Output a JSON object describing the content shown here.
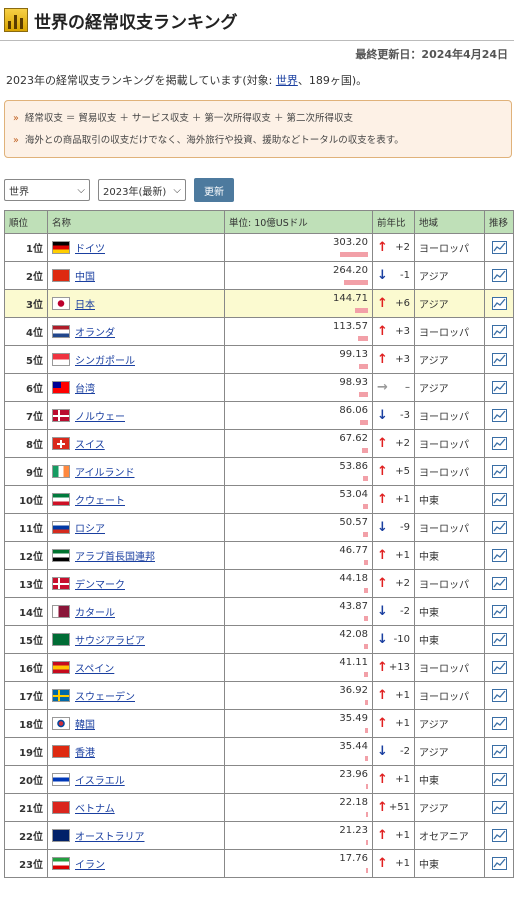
{
  "header": {
    "title": "世界の経常収支ランキング"
  },
  "updated": "最終更新日：2024年4月24日",
  "intro": {
    "before": "2023年の経常収支ランキングを掲載しています(対象: ",
    "link": "世界",
    "after": "、189ヶ国)。"
  },
  "notes": [
    "経常収支 ＝ 貿易収支 ＋ サービス収支 ＋ 第一次所得収支 ＋ 第二次所得収支",
    "海外との商品取引の収支だけでなく、海外旅行や投資、援助などトータルの収支を表す。"
  ],
  "controls": {
    "region": "世界",
    "year": "2023年(最新)",
    "update": "更新"
  },
  "table": {
    "headers": [
      "順位",
      "名称",
      "単位: 10億USドル",
      "前年比",
      "地域",
      "推移"
    ],
    "max_value": 303.2,
    "rows": [
      {
        "rank": "1位",
        "name": "ドイツ",
        "value": "303.20",
        "dir": "up",
        "change": "+2",
        "region": "ヨーロッパ",
        "flag": [
          "#000",
          "#dd0000",
          "#ffce00"
        ],
        "fd": "h"
      },
      {
        "rank": "2位",
        "name": "中国",
        "value": "264.20",
        "dir": "down",
        "change": "-1",
        "region": "アジア",
        "flag": [
          "#de2910",
          "#de2910",
          "#de2910"
        ],
        "fd": "h"
      },
      {
        "rank": "3位",
        "name": "日本",
        "value": "144.71",
        "dir": "up",
        "change": "+6",
        "region": "アジア",
        "flag": [
          "#fff",
          "#fff",
          "#fff"
        ],
        "fd": "jp",
        "highlight": true
      },
      {
        "rank": "4位",
        "name": "オランダ",
        "value": "113.57",
        "dir": "up",
        "change": "+3",
        "region": "ヨーロッパ",
        "flag": [
          "#ae1c28",
          "#fff",
          "#21468b"
        ],
        "fd": "h"
      },
      {
        "rank": "5位",
        "name": "シンガポール",
        "value": "99.13",
        "dir": "up",
        "change": "+3",
        "region": "アジア",
        "flag": [
          "#ef3340",
          "#fff",
          "#fff"
        ],
        "fd": "h2"
      },
      {
        "rank": "6位",
        "name": "台湾",
        "value": "98.93",
        "dir": "flat",
        "change": "–",
        "region": "アジア",
        "flag": [
          "#fe0000",
          "#000095",
          "#fe0000"
        ],
        "fd": "tw"
      },
      {
        "rank": "7位",
        "name": "ノルウェー",
        "value": "86.06",
        "dir": "down",
        "change": "-3",
        "region": "ヨーロッパ",
        "flag": [
          "#ba0c2f",
          "#00205b",
          "#fff"
        ],
        "fd": "nordic"
      },
      {
        "rank": "8位",
        "name": "スイス",
        "value": "67.62",
        "dir": "up",
        "change": "+2",
        "region": "ヨーロッパ",
        "flag": [
          "#da291c",
          "#fff",
          "#da291c"
        ],
        "fd": "ch"
      },
      {
        "rank": "9位",
        "name": "アイルランド",
        "value": "53.86",
        "dir": "up",
        "change": "+5",
        "region": "ヨーロッパ",
        "flag": [
          "#169b62",
          "#fff",
          "#ff883e"
        ],
        "fd": "v"
      },
      {
        "rank": "10位",
        "name": "クウェート",
        "value": "53.04",
        "dir": "up",
        "change": "+1",
        "region": "中東",
        "flag": [
          "#007a3d",
          "#fff",
          "#ce1126"
        ],
        "fd": "h"
      },
      {
        "rank": "11位",
        "name": "ロシア",
        "value": "50.57",
        "dir": "down",
        "change": "-9",
        "region": "ヨーロッパ",
        "flag": [
          "#fff",
          "#0039a6",
          "#d52b1e"
        ],
        "fd": "h"
      },
      {
        "rank": "12位",
        "name": "アラブ首長国連邦",
        "value": "46.77",
        "dir": "up",
        "change": "+1",
        "region": "中東",
        "flag": [
          "#00732f",
          "#fff",
          "#000"
        ],
        "fd": "h"
      },
      {
        "rank": "13位",
        "name": "デンマーク",
        "value": "44.18",
        "dir": "up",
        "change": "+2",
        "region": "ヨーロッパ",
        "flag": [
          "#c8102e",
          "#fff",
          "#fff"
        ],
        "fd": "nordic"
      },
      {
        "rank": "14位",
        "name": "カタール",
        "value": "43.87",
        "dir": "down",
        "change": "-2",
        "region": "中東",
        "flag": [
          "#fff",
          "#8a1538",
          "#8a1538"
        ],
        "fd": "v"
      },
      {
        "rank": "15位",
        "name": "サウジアラビア",
        "value": "42.08",
        "dir": "down",
        "change": "-10",
        "region": "中東",
        "flag": [
          "#006c35",
          "#006c35",
          "#006c35"
        ],
        "fd": "h"
      },
      {
        "rank": "16位",
        "name": "スペイン",
        "value": "41.11",
        "dir": "up",
        "change": "+13",
        "region": "ヨーロッパ",
        "flag": [
          "#c60b1e",
          "#ffc400",
          "#c60b1e"
        ],
        "fd": "h"
      },
      {
        "rank": "17位",
        "name": "スウェーデン",
        "value": "36.92",
        "dir": "up",
        "change": "+1",
        "region": "ヨーロッパ",
        "flag": [
          "#006aa7",
          "#fecc00",
          "#fecc00"
        ],
        "fd": "nordic"
      },
      {
        "rank": "18位",
        "name": "韓国",
        "value": "35.49",
        "dir": "up",
        "change": "+1",
        "region": "アジア",
        "flag": [
          "#fff",
          "#fff",
          "#fff"
        ],
        "fd": "kr"
      },
      {
        "rank": "19位",
        "name": "香港",
        "value": "35.44",
        "dir": "down",
        "change": "-2",
        "region": "アジア",
        "flag": [
          "#de2910",
          "#de2910",
          "#de2910"
        ],
        "fd": "h"
      },
      {
        "rank": "20位",
        "name": "イスラエル",
        "value": "23.96",
        "dir": "up",
        "change": "+1",
        "region": "中東",
        "flag": [
          "#fff",
          "#0038b8",
          "#fff"
        ],
        "fd": "h"
      },
      {
        "rank": "21位",
        "name": "ベトナム",
        "value": "22.18",
        "dir": "up",
        "change": "+51",
        "region": "アジア",
        "flag": [
          "#da251d",
          "#da251d",
          "#da251d"
        ],
        "fd": "h"
      },
      {
        "rank": "22位",
        "name": "オーストラリア",
        "value": "21.23",
        "dir": "up",
        "change": "+1",
        "region": "オセアニア",
        "flag": [
          "#012169",
          "#012169",
          "#012169"
        ],
        "fd": "h"
      },
      {
        "rank": "23位",
        "name": "イラン",
        "value": "17.76",
        "dir": "up",
        "change": "+1",
        "region": "中東",
        "flag": [
          "#239f40",
          "#fff",
          "#da0000"
        ],
        "fd": "h"
      }
    ]
  }
}
